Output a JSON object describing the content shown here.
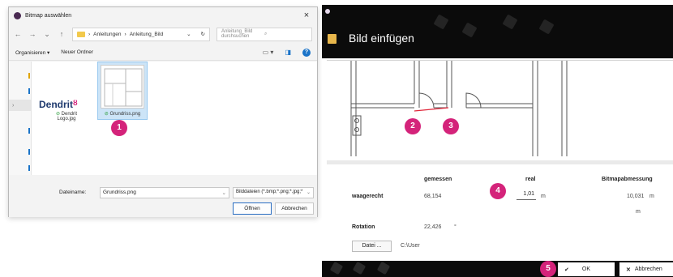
{
  "file_dialog": {
    "title": "Bitmap auswählen",
    "close": "×",
    "breadcrumb": [
      "Anleitungen",
      "Anleitung_Bild"
    ],
    "breadcrumb_sep": "›",
    "search_placeholder": "Anleitung_Bild durchsuchen",
    "toolbar": {
      "organize": "Organisieren ▾",
      "new_folder": "Neuer Ordner"
    },
    "files": [
      {
        "name_line1": "Dendrit",
        "name_line2": "Logo.jpg"
      },
      {
        "name_line1": "Grundriss.png"
      }
    ],
    "logo_text": "Dendrit",
    "filename_label": "Dateiname:",
    "filename_value": "Grundriss.png",
    "filetype_value": "Bilddateien (*.bmp;*.png;*.jpg;*",
    "open_button": "Öffnen",
    "cancel_button": "Abbrechen"
  },
  "image_dialog": {
    "title": "Bild einfügen",
    "headers": {
      "measured": "gemessen",
      "real": "real",
      "bitmap": "Bitmapabmessung"
    },
    "horizontal": {
      "label": "waagerecht",
      "measured": "68,154",
      "real": "1,01",
      "real_unit": "m",
      "bitmap": "10,031",
      "bitmap_unit": "m"
    },
    "extra_unit": "m",
    "rotation": {
      "label": "Rotation",
      "value": "22,426",
      "unit": "°"
    },
    "file_button": "Datei ...",
    "file_path": "C:\\User",
    "ok_button": "OK",
    "cancel_button": "Abbrechen"
  },
  "badges": [
    "1",
    "2",
    "3",
    "4",
    "5"
  ],
  "colors": {
    "accent": "#d4237a",
    "dark": "#0b0b0b",
    "dialog_bg": "#f3f3f3"
  }
}
